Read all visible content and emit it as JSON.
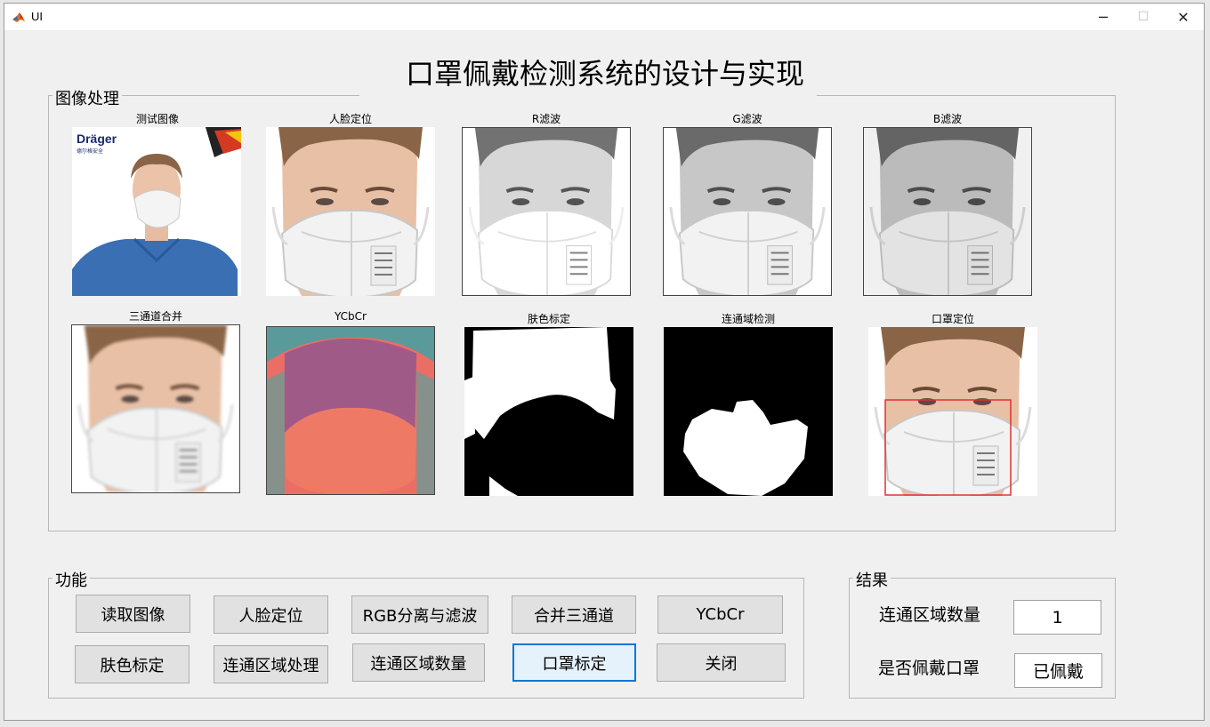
{
  "window": {
    "title": "UI",
    "minimize_glyph": "─",
    "maximize_glyph": "☐",
    "close_glyph": "✕"
  },
  "main_title": "口罩佩戴检测系统的设计与实现",
  "image_panel": {
    "title": "图像处理",
    "axes": [
      {
        "caption": "测试图像",
        "image": "original-photo",
        "brand_text": "Dräger",
        "brand_subtext": "德尔格安全"
      },
      {
        "caption": "人脸定位",
        "image": "face-crop-color"
      },
      {
        "caption": "R滤波",
        "image": "face-crop-gray-r"
      },
      {
        "caption": "G滤波",
        "image": "face-crop-gray-g"
      },
      {
        "caption": "B滤波",
        "image": "face-crop-gray-b"
      },
      {
        "caption": "三通道合并",
        "image": "face-crop-merged"
      },
      {
        "caption": "YCbCr",
        "image": "face-crop-ycbcr"
      },
      {
        "caption": "肤色标定",
        "image": "skin-mask-binary"
      },
      {
        "caption": "连通域检测",
        "image": "connected-region-binary"
      },
      {
        "caption": "口罩定位",
        "image": "face-crop-with-mask-box"
      }
    ]
  },
  "functions_panel": {
    "title": "功能",
    "buttons": [
      "读取图像",
      "人脸定位",
      "RGB分离与滤波",
      "合并三通道",
      "YCbCr",
      "肤色标定",
      "连通区域处理",
      "连通区域数量",
      "口罩标定",
      "关闭"
    ]
  },
  "results_panel": {
    "title": "结果",
    "region_count_label": "连通区域数量",
    "region_count_value": "1",
    "mask_status_label": "是否佩戴口罩",
    "mask_status_value": "已佩戴"
  },
  "colors": {
    "window_bg": "#f0f0f0",
    "button_bg": "#e1e1e1",
    "button_active_border": "#0078d7",
    "detection_box": "#e03030"
  }
}
